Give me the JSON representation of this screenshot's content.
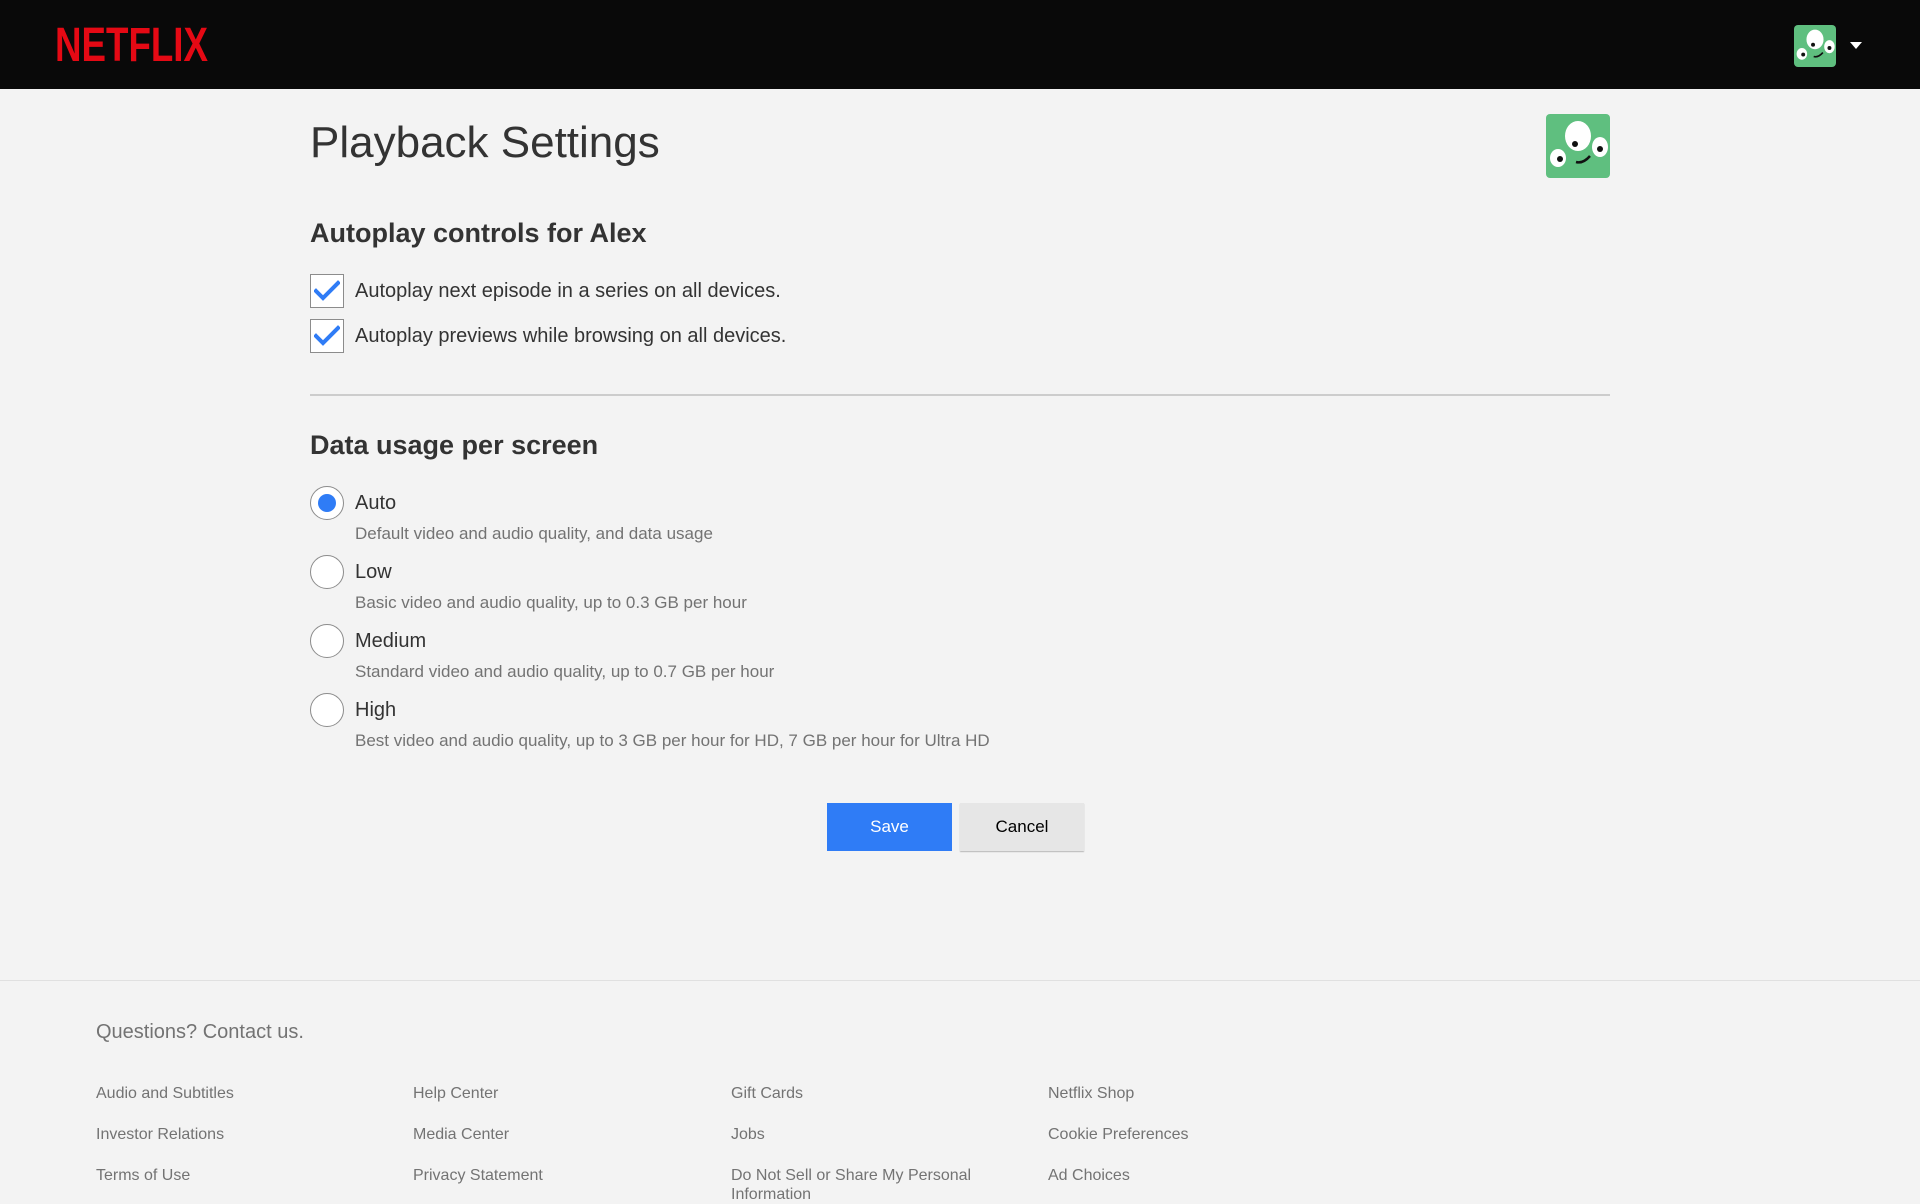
{
  "header": {
    "logo_text": "NETFLIX",
    "brand_color": "#e50914"
  },
  "main": {
    "title": "Playback Settings",
    "autoplay_section": {
      "title": "Autoplay controls for Alex",
      "options": [
        {
          "label": "Autoplay next episode in a series on all devices.",
          "checked": true
        },
        {
          "label": "Autoplay previews while browsing on all devices.",
          "checked": true
        }
      ]
    },
    "data_section": {
      "title": "Data usage per screen",
      "selected": "Auto",
      "options": [
        {
          "label": "Auto",
          "description": "Default video and audio quality, and data usage"
        },
        {
          "label": "Low",
          "description": "Basic video and audio quality, up to 0.3 GB per hour"
        },
        {
          "label": "Medium",
          "description": "Standard video and audio quality, up to 0.7 GB per hour"
        },
        {
          "label": "High",
          "description": "Best video and audio quality, up to 3 GB per hour for HD, 7 GB per hour for Ultra HD"
        }
      ]
    },
    "buttons": {
      "save": "Save",
      "cancel": "Cancel"
    },
    "accent_color": "#2f7cf6",
    "avatar_color": "#5fbf7f"
  },
  "footer": {
    "contact": "Questions? Contact us.",
    "links": [
      [
        "Audio and Subtitles",
        "Investor Relations",
        "Terms of Use"
      ],
      [
        "Help Center",
        "Media Center",
        "Privacy Statement"
      ],
      [
        "Gift Cards",
        "Jobs",
        "Do Not Sell or Share My Personal Information"
      ],
      [
        "Netflix Shop",
        "Cookie Preferences",
        "Ad Choices"
      ]
    ]
  }
}
